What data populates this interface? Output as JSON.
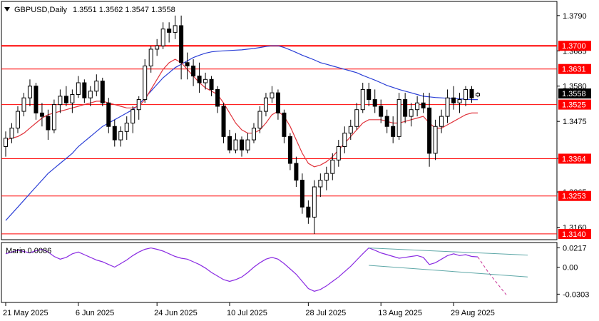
{
  "header": {
    "symbol_tf": "GBPUSD,Daily",
    "ohlc": "1.3551 1.3562 1.3547 1.3558",
    "menu_icon": "triangle-down-icon"
  },
  "indicator": {
    "label": "Marin 0.0086"
  },
  "colors": {
    "level_line": "#ff0000",
    "ma_fast": "#e0343c",
    "ma_slow": "#2b3fd6",
    "oscillator": "#8a2be2",
    "channel": "#5fa8a8",
    "forecast": "#c83296",
    "current_price_tag": "#000000"
  },
  "chart_data": [
    {
      "type": "candlestick",
      "title": "GBPUSD,Daily",
      "x_ticks": [
        "21 May 2025",
        "6 Jun 2025",
        "24 Jun 2025",
        "10 Jul 2025",
        "28 Jul 2025",
        "13 Aug 2025",
        "29 Aug 2025"
      ],
      "y_ticks": [
        "1.3790",
        "1.3685",
        "1.3580",
        "1.3475",
        "1.3365",
        "1.3265",
        "1.3160"
      ],
      "ylim": [
        1.3125,
        1.383
      ],
      "price_levels": [
        {
          "label": "1.3700",
          "value": 1.37,
          "style": "thick"
        },
        {
          "label": "1.3631",
          "value": 1.3631,
          "style": "thin"
        },
        {
          "label": "1.3525",
          "value": 1.3525,
          "style": "thin"
        },
        {
          "label": "1.3364",
          "value": 1.3364,
          "style": "thin"
        },
        {
          "label": "1.3253",
          "value": 1.3253,
          "style": "thin"
        },
        {
          "label": "1.3140",
          "value": 1.314,
          "style": "thin"
        }
      ],
      "current_price": "1.3558",
      "ohlc": [
        [
          1.34,
          1.3445,
          1.337,
          1.3425
        ],
        [
          1.3425,
          1.347,
          1.341,
          1.3455
        ],
        [
          1.3455,
          1.352,
          1.344,
          1.3505
        ],
        [
          1.3505,
          1.356,
          1.349,
          1.3545
        ],
        [
          1.3545,
          1.36,
          1.352,
          1.358
        ],
        [
          1.358,
          1.359,
          1.348,
          1.35
        ],
        [
          1.35,
          1.353,
          1.346,
          1.349
        ],
        [
          1.349,
          1.351,
          1.342,
          1.345
        ],
        [
          1.345,
          1.354,
          1.344,
          1.3525
        ],
        [
          1.3525,
          1.357,
          1.35,
          1.355
        ],
        [
          1.355,
          1.358,
          1.352,
          1.353
        ],
        [
          1.353,
          1.357,
          1.35,
          1.3555
        ],
        [
          1.3555,
          1.361,
          1.3545,
          1.359
        ],
        [
          1.359,
          1.36,
          1.353,
          1.3545
        ],
        [
          1.3545,
          1.358,
          1.352,
          1.3565
        ],
        [
          1.3565,
          1.3615,
          1.355,
          1.3595
        ],
        [
          1.3595,
          1.3605,
          1.352,
          1.353
        ],
        [
          1.353,
          1.3545,
          1.344,
          1.346
        ],
        [
          1.346,
          1.348,
          1.34,
          1.342
        ],
        [
          1.342,
          1.346,
          1.34,
          1.3445
        ],
        [
          1.3445,
          1.349,
          1.342,
          1.347
        ],
        [
          1.347,
          1.352,
          1.344,
          1.351
        ],
        [
          1.351,
          1.355,
          1.348,
          1.354
        ],
        [
          1.354,
          1.366,
          1.353,
          1.364
        ],
        [
          1.364,
          1.37,
          1.362,
          1.369
        ],
        [
          1.369,
          1.372,
          1.367,
          1.37
        ],
        [
          1.37,
          1.377,
          1.369,
          1.375
        ],
        [
          1.375,
          1.377,
          1.371,
          1.374
        ],
        [
          1.374,
          1.379,
          1.372,
          1.376
        ],
        [
          1.376,
          1.379,
          1.36,
          1.365
        ],
        [
          1.365,
          1.368,
          1.36,
          1.364
        ],
        [
          1.364,
          1.366,
          1.358,
          1.361
        ],
        [
          1.361,
          1.365,
          1.356,
          1.359
        ],
        [
          1.359,
          1.362,
          1.357,
          1.36
        ],
        [
          1.36,
          1.361,
          1.355,
          1.357
        ],
        [
          1.357,
          1.358,
          1.35,
          1.352
        ],
        [
          1.352,
          1.353,
          1.341,
          1.343
        ],
        [
          1.343,
          1.345,
          1.338,
          1.339
        ],
        [
          1.339,
          1.344,
          1.338,
          1.342
        ],
        [
          1.342,
          1.343,
          1.337,
          1.339
        ],
        [
          1.339,
          1.344,
          1.338,
          1.342
        ],
        [
          1.342,
          1.347,
          1.341,
          1.3455
        ],
        [
          1.3455,
          1.352,
          1.344,
          1.3505
        ],
        [
          1.3505,
          1.356,
          1.349,
          1.3545
        ],
        [
          1.3545,
          1.358,
          1.353,
          1.356
        ],
        [
          1.356,
          1.357,
          1.348,
          1.35
        ],
        [
          1.35,
          1.351,
          1.341,
          1.343
        ],
        [
          1.343,
          1.344,
          1.333,
          1.335
        ],
        [
          1.335,
          1.337,
          1.328,
          1.33
        ],
        [
          1.33,
          1.332,
          1.32,
          1.322
        ],
        [
          1.322,
          1.324,
          1.317,
          1.319
        ],
        [
          1.319,
          1.33,
          1.314,
          1.328
        ],
        [
          1.328,
          1.332,
          1.325,
          1.33
        ],
        [
          1.33,
          1.334,
          1.327,
          1.332
        ],
        [
          1.332,
          1.338,
          1.33,
          1.336
        ],
        [
          1.336,
          1.342,
          1.334,
          1.34
        ],
        [
          1.34,
          1.346,
          1.338,
          1.344
        ],
        [
          1.344,
          1.348,
          1.342,
          1.346
        ],
        [
          1.346,
          1.353,
          1.345,
          1.351
        ],
        [
          1.351,
          1.359,
          1.35,
          1.357
        ],
        [
          1.357,
          1.359,
          1.352,
          1.354
        ],
        [
          1.354,
          1.357,
          1.35,
          1.352
        ],
        [
          1.352,
          1.354,
          1.347,
          1.349
        ],
        [
          1.349,
          1.351,
          1.344,
          1.346
        ],
        [
          1.346,
          1.349,
          1.341,
          1.343
        ],
        [
          1.343,
          1.356,
          1.342,
          1.354
        ],
        [
          1.354,
          1.356,
          1.347,
          1.349
        ],
        [
          1.349,
          1.353,
          1.346,
          1.351
        ],
        [
          1.351,
          1.355,
          1.349,
          1.353
        ],
        [
          1.353,
          1.356,
          1.35,
          1.3515
        ],
        [
          1.3515,
          1.356,
          1.334,
          1.338
        ],
        [
          1.338,
          1.348,
          1.336,
          1.346
        ],
        [
          1.346,
          1.351,
          1.344,
          1.349
        ],
        [
          1.349,
          1.357,
          1.347,
          1.3545
        ],
        [
          1.3545,
          1.358,
          1.351,
          1.353
        ],
        [
          1.353,
          1.356,
          1.35,
          1.354
        ],
        [
          1.354,
          1.358,
          1.352,
          1.357
        ],
        [
          1.357,
          1.358,
          1.353,
          1.3545
        ],
        [
          1.3551,
          1.3562,
          1.3547,
          1.3558
        ]
      ],
      "ma_fast": [
        1.342,
        1.3425,
        1.343,
        1.344,
        1.3455,
        1.347,
        1.3485,
        1.3495,
        1.35,
        1.3505,
        1.351,
        1.3515,
        1.352,
        1.3525,
        1.353,
        1.3535,
        1.3535,
        1.353,
        1.3525,
        1.352,
        1.3515,
        1.3515,
        1.352,
        1.354,
        1.357,
        1.36,
        1.363,
        1.365,
        1.366,
        1.365,
        1.363,
        1.361,
        1.359,
        1.3575,
        1.3565,
        1.3555,
        1.353,
        1.35,
        1.347,
        1.345,
        1.344,
        1.344,
        1.345,
        1.347,
        1.3495,
        1.3505,
        1.349,
        1.346,
        1.342,
        1.338,
        1.335,
        1.334,
        1.3345,
        1.3355,
        1.337,
        1.339,
        1.341,
        1.343,
        1.345,
        1.347,
        1.348,
        1.348,
        1.348,
        1.3475,
        1.347,
        1.347,
        1.3475,
        1.348,
        1.3485,
        1.349,
        1.347,
        1.3455,
        1.3455,
        1.3465,
        1.3475,
        1.3485,
        1.3495,
        1.35,
        1.35
      ],
      "ma_slow": [
        1.318,
        1.32,
        1.322,
        1.324,
        1.326,
        1.328,
        1.33,
        1.332,
        1.3335,
        1.335,
        1.3365,
        1.338,
        1.34,
        1.3415,
        1.343,
        1.3445,
        1.346,
        1.347,
        1.348,
        1.349,
        1.35,
        1.351,
        1.3525,
        1.3545,
        1.3565,
        1.3585,
        1.3605,
        1.362,
        1.3635,
        1.3645,
        1.3655,
        1.3665,
        1.3672,
        1.3678,
        1.3682,
        1.3684,
        1.3685,
        1.3686,
        1.3687,
        1.3688,
        1.369,
        1.3692,
        1.3695,
        1.3698,
        1.37,
        1.37,
        1.3695,
        1.3688,
        1.368,
        1.3672,
        1.3665,
        1.3658,
        1.365,
        1.3645,
        1.364,
        1.3635,
        1.363,
        1.3625,
        1.362,
        1.3612,
        1.3605,
        1.3598,
        1.359,
        1.3582,
        1.3576,
        1.357,
        1.3565,
        1.356,
        1.3555,
        1.355,
        1.3548,
        1.3546,
        1.3545,
        1.3544,
        1.3543,
        1.3542,
        1.3541,
        1.354,
        1.354
      ],
      "oscillator_ylim": [
        -0.038,
        0.026
      ],
      "oscillator_ticks": [
        "0.0217",
        "0.00",
        "-0.0303"
      ],
      "oscillator": [
        0.015,
        0.017,
        0.019,
        0.0175,
        0.016,
        0.0185,
        0.02,
        0.017,
        0.012,
        0.009,
        0.011,
        0.015,
        0.017,
        0.014,
        0.011,
        0.008,
        0.006,
        0.003,
        0.0,
        0.004,
        0.008,
        0.013,
        0.017,
        0.02,
        0.0215,
        0.02,
        0.018,
        0.015,
        0.012,
        0.01,
        0.009,
        0.006,
        0.003,
        -0.001,
        -0.006,
        -0.01,
        -0.014,
        -0.016,
        -0.014,
        -0.011,
        -0.006,
        0.0,
        0.005,
        0.009,
        0.011,
        0.009,
        0.004,
        -0.002,
        -0.008,
        -0.016,
        -0.024,
        -0.027,
        -0.025,
        -0.021,
        -0.016,
        -0.011,
        -0.005,
        0.001,
        0.008,
        0.015,
        0.0215,
        0.019,
        0.016,
        0.014,
        0.012,
        0.01,
        0.011,
        0.012,
        0.013,
        0.011,
        0.003,
        0.005,
        0.009,
        0.013,
        0.015,
        0.013,
        0.014,
        0.012,
        0.0115
      ],
      "oscillator_forecast": [
        0.0115,
        -0.006,
        -0.031
      ],
      "trend_channel": {
        "upper": [
          0.0215,
          0.0135
        ],
        "lower": [
          0.002,
          -0.011
        ]
      }
    }
  ]
}
